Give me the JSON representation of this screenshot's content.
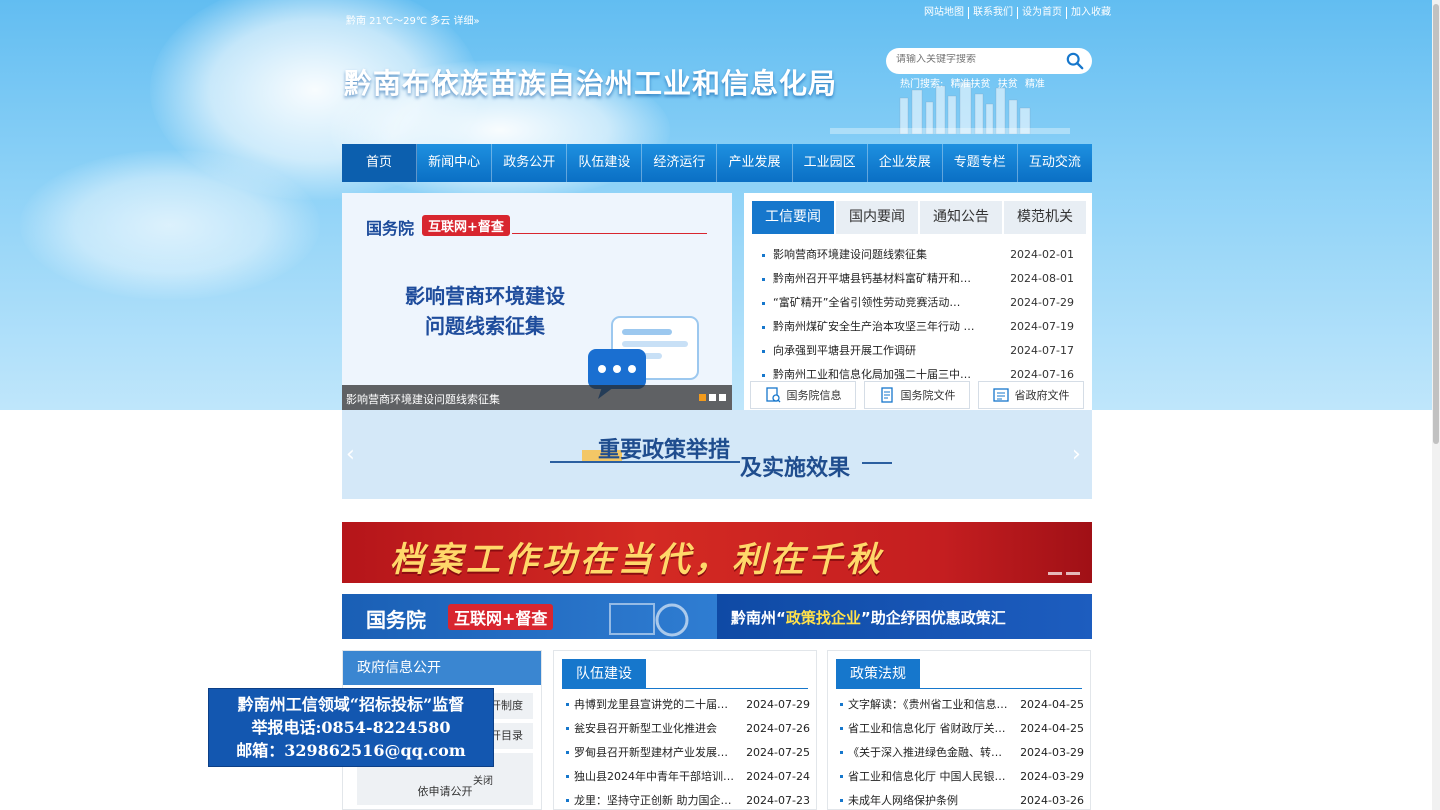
{
  "header": {
    "weather": "黔南 21℃～29℃ 多云 详细»",
    "top_links": [
      "网站地图",
      "联系我们",
      "设为首页",
      "加入收藏"
    ],
    "site_title": "黔南布依族苗族自治州工业和信息化局",
    "search_placeholder": "请输入关键字搜索",
    "hot_label": "热门搜索:",
    "hot_terms": [
      "精准扶贫",
      "扶贫",
      "精准"
    ]
  },
  "nav": [
    "首页",
    "新闻中心",
    "政务公开",
    "队伍建设",
    "经济运行",
    "产业发展",
    "工业园区",
    "企业发展",
    "专题专栏",
    "互动交流"
  ],
  "slider": {
    "gw": "国务院",
    "badge": "互联网+督查",
    "heading_line1": "影响营商环境建设",
    "heading_line2": "问题线索征集",
    "caption": "影响营商环境建设问题线索征集"
  },
  "news": {
    "tabs": [
      "工信要闻",
      "国内要闻",
      "通知公告",
      "模范机关"
    ],
    "items": [
      {
        "title": "影响营商环境建设问题线索征集",
        "date": "2024-02-01"
      },
      {
        "title": "黔南州召开平塘县钙基材料富矿精开和…",
        "date": "2024-08-01"
      },
      {
        "title": "“富矿精开”全省引领性劳动竞赛活动…",
        "date": "2024-07-29"
      },
      {
        "title": "黔南州煤矿安全生产治本攻坚三年行动 …",
        "date": "2024-07-19"
      },
      {
        "title": "向承强到平塘县开展工作调研",
        "date": "2024-07-17"
      },
      {
        "title": "黔南州工业和信息化局加强二十届三中…",
        "date": "2024-07-16"
      }
    ],
    "quick_links": [
      "国务院信息",
      "国务院文件",
      "省政府文件"
    ]
  },
  "policy_banner": {
    "line1": "重要政策举措",
    "line2": "及实施效果"
  },
  "archive_banner": "档案工作功在当代，利在千秋",
  "blue_banner": {
    "left_gw": "国务院",
    "left_badge": "互联网+督查",
    "right_pre": "黔南州“",
    "right_highlight": "政策找企业",
    "right_post": "”助企纾困优惠政策汇"
  },
  "gov_info": {
    "title": "政府信息公开",
    "rows": [
      "开制度",
      "开目录",
      "",
      "依申请公开"
    ]
  },
  "team": {
    "title": "队伍建设",
    "items": [
      {
        "title": "冉博到龙里县宣讲党的二十届三…",
        "date": "2024-07-29"
      },
      {
        "title": "瓮安县召开新型工业化推进会",
        "date": "2024-07-26"
      },
      {
        "title": "罗甸县召开新型建材产业发展企…",
        "date": "2024-07-25"
      },
      {
        "title": "独山县2024年中青年干部培训班…",
        "date": "2024-07-24"
      },
      {
        "title": "龙里：坚持守正创新 助力国企改…",
        "date": "2024-07-23"
      }
    ]
  },
  "laws": {
    "title": "政策法规",
    "items": [
      {
        "title": "文字解读：《贵州省工业和信息…",
        "date": "2024-04-25"
      },
      {
        "title": "省工业和信息化厅 省财政厅关于…",
        "date": "2024-04-25"
      },
      {
        "title": "《关于深入推进绿色金融、转型…",
        "date": "2024-03-29"
      },
      {
        "title": "省工业和信息化厅 中国人民银行…",
        "date": "2024-03-29"
      },
      {
        "title": "未成年人网络保护条例",
        "date": "2024-03-26"
      }
    ]
  },
  "popup": {
    "line1": "黔南州工信领域“招标投标”监督",
    "line2": "举报电话:0854-8224580",
    "line3": "邮箱：329862516@qq.com",
    "close": "关闭"
  }
}
